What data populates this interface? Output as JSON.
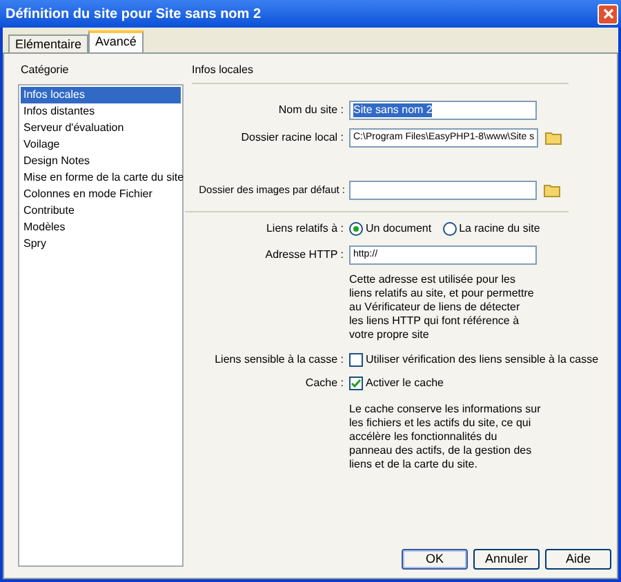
{
  "window": {
    "title": "Définition du site pour Site sans nom 2"
  },
  "tabs": [
    {
      "label": "Elémentaire",
      "selected": false
    },
    {
      "label": "Avancé",
      "selected": true
    }
  ],
  "sidebar": {
    "heading": "Catégorie",
    "items": [
      {
        "label": "Infos locales",
        "selected": true
      },
      {
        "label": "Infos distantes",
        "selected": false
      },
      {
        "label": "Serveur d'évaluation",
        "selected": false
      },
      {
        "label": "Voilage",
        "selected": false
      },
      {
        "label": "Design Notes",
        "selected": false
      },
      {
        "label": "Mise en forme de la carte du site",
        "selected": false
      },
      {
        "label": "Colonnes en mode Fichier",
        "selected": false
      },
      {
        "label": "Contribute",
        "selected": false
      },
      {
        "label": "Modèles",
        "selected": false
      },
      {
        "label": "Spry",
        "selected": false
      }
    ]
  },
  "section_title": "Infos locales",
  "site_name": {
    "label": "Nom du site :",
    "value": "Site sans nom 2"
  },
  "local_root": {
    "label": "Dossier racine local :",
    "value": "C:\\Program Files\\EasyPHP1-8\\www\\Site s"
  },
  "images_folder": {
    "label": "Dossier des images par défaut :"
  },
  "relative_links": {
    "label": "Liens relatifs à :",
    "options": [
      {
        "label": "Un document",
        "selected": true
      },
      {
        "label": "La racine du site",
        "selected": false
      }
    ]
  },
  "http_address": {
    "label": "Adresse HTTP :",
    "value": "http://",
    "help": "Cette adresse est utilisée pour les liens relatifs au site, et pour permettre au Vérificateur de liens de détecter les liens HTTP qui font référence à votre propre site"
  },
  "case_sensitive": {
    "label": "Liens sensible à la casse :",
    "option": "Utiliser vérification des liens sensible à la casse",
    "checked": false
  },
  "cache": {
    "label": "Cache :",
    "option": "Activer le cache",
    "checked": true,
    "help": "Le cache conserve les informations sur les fichiers et les actifs du site, ce qui accélère les fonctionnalités du panneau des actifs, de la gestion des liens et de la carte du site."
  },
  "buttons": [
    "OK",
    "Annuler",
    "Aide"
  ]
}
